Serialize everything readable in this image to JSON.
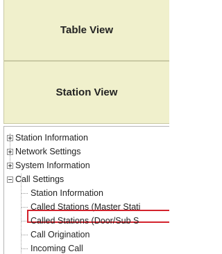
{
  "views": {
    "table": "Table View",
    "station": "Station View"
  },
  "tree": {
    "station_information": "Station Information",
    "network_settings": "Network Settings",
    "system_information": "System Information",
    "call_settings": "Call Settings",
    "children": {
      "station_information": "Station Information",
      "called_master": "Called Stations (Master Stati",
      "called_door_sub": "Called Stations (Door/Sub S",
      "call_origination": "Call Origination",
      "incoming_call": "Incoming Call"
    }
  }
}
